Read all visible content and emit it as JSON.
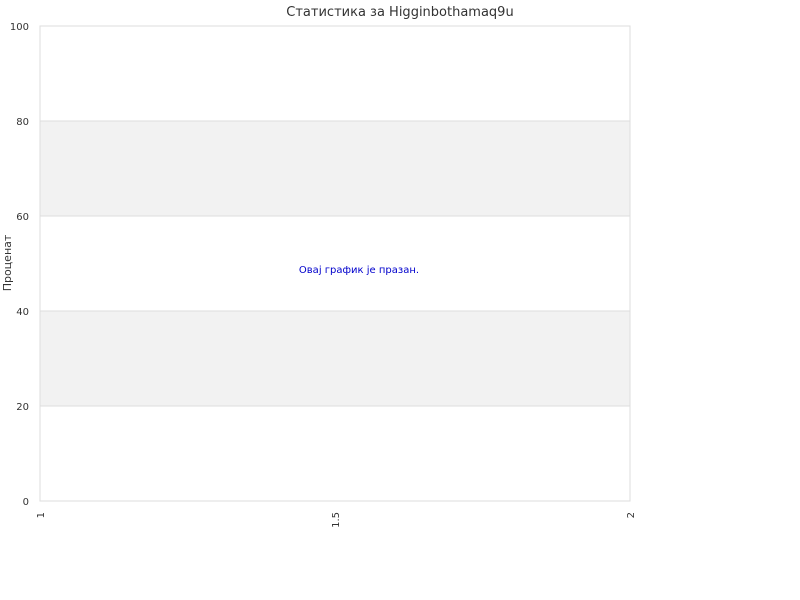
{
  "chart_data": {
    "type": "line",
    "title": "Статистика за Higginbothamaq9u",
    "ylabel": "Проценат",
    "xlabel": "",
    "ylim": [
      0,
      100
    ],
    "xlim": [
      1,
      2
    ],
    "yticks": [
      "0",
      "20",
      "40",
      "60",
      "80",
      "100"
    ],
    "xticks": [
      "1",
      "1.5",
      "2"
    ],
    "series": [],
    "empty_message": "Овај график је празан.",
    "grid": true,
    "band_color": "#f2f2f2",
    "gridline_color": "#dddddd",
    "empty_message_color": "#0000cc"
  }
}
